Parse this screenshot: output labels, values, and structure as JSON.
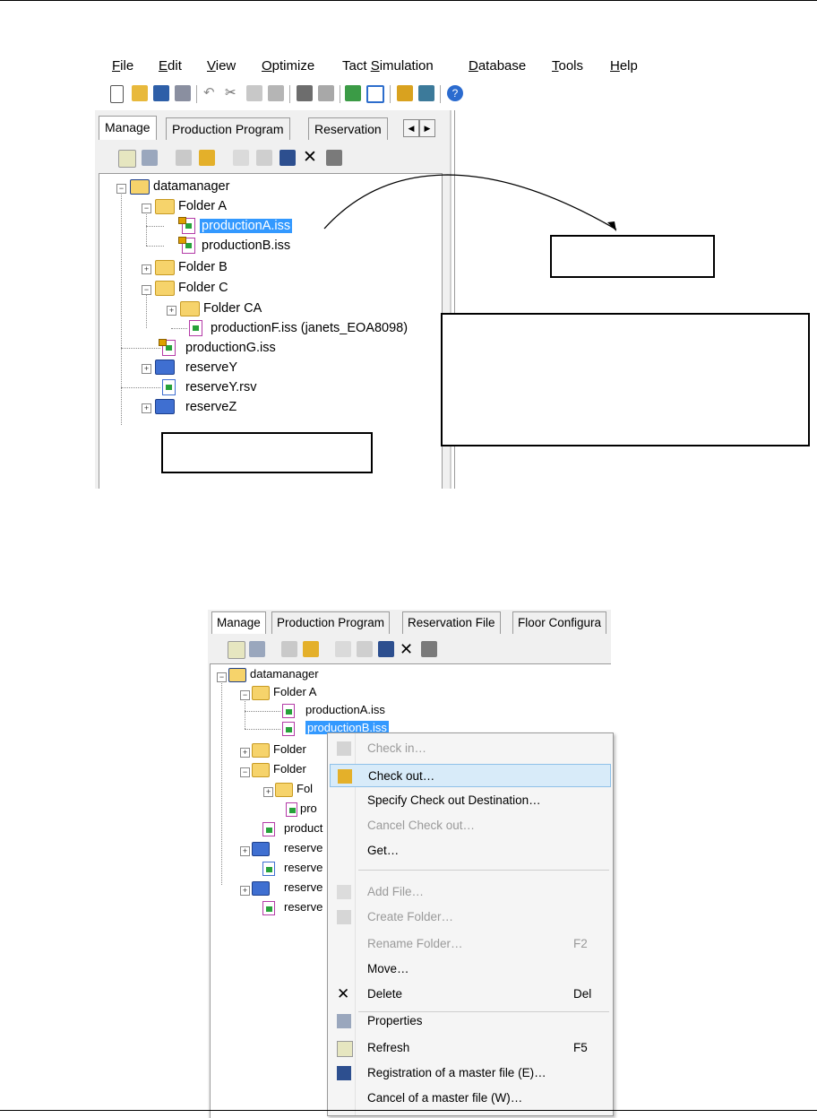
{
  "menubar": {
    "items": [
      "File",
      "Edit",
      "View",
      "Optimize",
      "Tact Simulation",
      "Database",
      "Tools",
      "Help"
    ],
    "underline": [
      "F",
      "E",
      "V",
      "O",
      "S",
      "D",
      "T",
      "H"
    ]
  },
  "toolbar": {
    "icons": [
      "new-icon",
      "open-icon",
      "save-icon",
      "print-icon",
      "undo-icon",
      "cut-icon",
      "copy-icon",
      "paste-icon",
      "find-icon",
      "find-next-icon",
      "import-icon",
      "export-icon",
      "sync-icon",
      "compare-icon",
      "help-icon"
    ]
  },
  "pane1": {
    "tabs": [
      "Manage",
      "Production Program",
      "Reservation"
    ],
    "tree": {
      "root": "datamanager",
      "folderA": "Folder A",
      "fileA": "productionA.iss",
      "fileB": "productionB.iss",
      "folderB": "Folder B",
      "folderC": "Folder C",
      "folderCA": "Folder CA",
      "fileF": "productionF.iss (janets_EOA8098)",
      "fileG": "productionG.iss",
      "reserveY": "reserveY",
      "reserveYrsv": "reserveY.rsv",
      "reserveZ": "reserveZ"
    }
  },
  "pane2": {
    "tabs": [
      "Manage",
      "Production Program",
      "Reservation File",
      "Floor Configura"
    ],
    "tree": {
      "root": "datamanager",
      "folderA": "Folder A",
      "fileA": "productionA.iss",
      "fileB": "productionB.iss",
      "folder1": "Folder",
      "folder2": "Folder",
      "fol": "Fol",
      "pro": "pro",
      "product": "product",
      "reserve1": "reserve",
      "reserve2": "reserve",
      "reserve3": "reserve",
      "reserve4": "reserve"
    }
  },
  "context_menu": {
    "items": [
      {
        "label": "Check in…",
        "shortcut": "",
        "disabled": true,
        "icon": "check-in-icon"
      },
      {
        "label": "Check out…",
        "shortcut": "",
        "disabled": false,
        "icon": "check-out-icon",
        "highlighted": true
      },
      {
        "label": "Specify Check out Destination…",
        "shortcut": "",
        "disabled": false,
        "icon": ""
      },
      {
        "label": "Cancel Check out…",
        "shortcut": "",
        "disabled": true,
        "icon": ""
      },
      {
        "label": "Get…",
        "shortcut": "",
        "disabled": false,
        "icon": ""
      },
      {
        "label": "Add File…",
        "shortcut": "",
        "disabled": true,
        "icon": "add-file-icon"
      },
      {
        "label": "Create Folder…",
        "shortcut": "",
        "disabled": true,
        "icon": "create-folder-icon"
      },
      {
        "label": "Rename Folder…",
        "shortcut": "F2",
        "disabled": true,
        "icon": ""
      },
      {
        "label": "Move…",
        "shortcut": "",
        "disabled": false,
        "icon": ""
      },
      {
        "label": "Delete",
        "shortcut": "Del",
        "disabled": false,
        "icon": "delete-icon"
      },
      {
        "label": "Properties",
        "shortcut": "",
        "disabled": false,
        "icon": "properties-icon"
      },
      {
        "label": "Refresh",
        "shortcut": "F5",
        "disabled": false,
        "icon": "refresh-icon"
      },
      {
        "label": "Registration of a master file (E)…",
        "shortcut": "",
        "disabled": false,
        "icon": "register-master-icon"
      },
      {
        "label": "Cancel of a master file (W)…",
        "shortcut": "",
        "disabled": false,
        "icon": ""
      }
    ]
  },
  "colors": {
    "selection": "#3399ff",
    "menu_highlight": "#d8ebf9",
    "folder": "#f6d36b",
    "reserve_folder": "#3f6fd1"
  }
}
